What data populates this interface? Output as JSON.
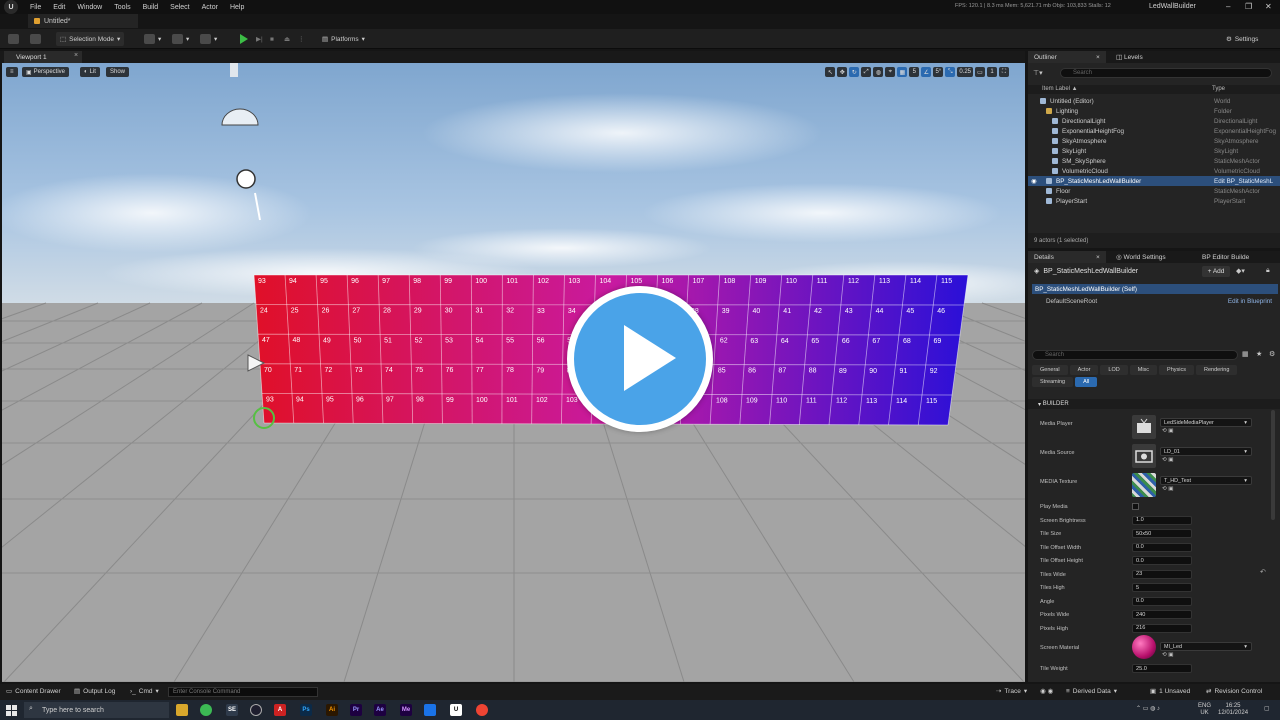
{
  "menubar": {
    "logo_text": "U",
    "items": [
      "File",
      "Edit",
      "Window",
      "Tools",
      "Build",
      "Select",
      "Actor",
      "Help"
    ],
    "perf": "FPS: 120.1  |  8.3 ms  Mem: 5,621.71 mb  Objs: 103,833  Stalls: 12",
    "window_title": "LedWallBuilder",
    "controls": [
      "–",
      "❐",
      "✕"
    ]
  },
  "doc_tab": {
    "label": "Untitled*"
  },
  "toolbar": {
    "selection_mode": "Selection Mode",
    "platforms": "Platforms",
    "settings": "Settings"
  },
  "viewport": {
    "tab_label": "Viewport 1",
    "perspective": "Perspective",
    "lit": "Lit",
    "show": "Show",
    "grid_size": "5",
    "angle": "5°",
    "scale": "0.25",
    "camera_speed": "1",
    "tile_numbers_top": [
      "93",
      "94",
      "95",
      "96",
      "97",
      "98",
      "99",
      "100",
      "101",
      "102",
      "103",
      "104",
      "105",
      "106",
      "107",
      "108",
      "109",
      "110",
      "111",
      "112",
      "113",
      "114",
      "115"
    ],
    "tile_rows": 5,
    "tile_cols": 23
  },
  "outliner": {
    "tab_label": "Outliner",
    "levels_tab": "Levels",
    "search_placeholder": "Search",
    "col_label": "Item Label ▲",
    "col_type": "Type",
    "rows": [
      {
        "label": "Untitled (Editor)",
        "type": "World",
        "indent": 2,
        "folder": false
      },
      {
        "label": "Lighting",
        "type": "Folder",
        "indent": 3,
        "folder": true
      },
      {
        "label": "DirectionalLight",
        "type": "DirectionalLight",
        "indent": 4,
        "folder": false
      },
      {
        "label": "ExponentialHeightFog",
        "type": "ExponentialHeightFog",
        "indent": 4,
        "folder": false
      },
      {
        "label": "SkyAtmosphere",
        "type": "SkyAtmosphere",
        "indent": 4,
        "folder": false
      },
      {
        "label": "SkyLight",
        "type": "SkyLight",
        "indent": 4,
        "folder": false
      },
      {
        "label": "SM_SkySphere",
        "type": "StaticMeshActor",
        "indent": 4,
        "folder": false
      },
      {
        "label": "VolumetricCloud",
        "type": "VolumetricCloud",
        "indent": 4,
        "folder": false
      },
      {
        "label": "BP_StaticMeshLedWallBuilder",
        "type": "Edit BP_StaticMeshL",
        "indent": 3,
        "folder": false,
        "selected": true
      },
      {
        "label": "Floor",
        "type": "StaticMeshActor",
        "indent": 3,
        "folder": false
      },
      {
        "label": "PlayerStart",
        "type": "PlayerStart",
        "indent": 3,
        "folder": false
      }
    ],
    "footer": "9 actors (1 selected)"
  },
  "details": {
    "tab_label": "Details",
    "world_settings_tab": "World Settings",
    "bp_editor_tab": "BP Editor Builde",
    "actor_name": "BP_StaticMeshLedWallBuilder",
    "add_label": "+ Add",
    "self_component": "BP_StaticMeshLedWallBuilder (Self)",
    "root_component": "DefaultSceneRoot",
    "edit_in_blueprint": "Edit in Blueprint",
    "search_placeholder": "Search",
    "categories": [
      "General",
      "Actor",
      "LOD",
      "Misc",
      "Physics",
      "Rendering",
      "Streaming",
      "All"
    ],
    "section": "BUILDER",
    "media_player_label": "Media Player",
    "media_player_value": "LedSideMediaPlayer",
    "media_source_label": "Media Source",
    "media_source_value": "LD_01",
    "media_texture_label": "MEDIA Texture",
    "media_texture_value": "T_HD_Test",
    "props": [
      {
        "label": "Play Media",
        "value": null
      },
      {
        "label": "Screen Brightness",
        "value": "1.0"
      },
      {
        "label": "Tile Size",
        "value": "50x50"
      },
      {
        "label": "Tile Offset Width",
        "value": "0.0"
      },
      {
        "label": "Tile Offset Height",
        "value": "0.0"
      },
      {
        "label": "Tiles Wide",
        "value": "23"
      },
      {
        "label": "Tiles High",
        "value": "5"
      },
      {
        "label": "Angle",
        "value": "0.0"
      },
      {
        "label": "Pixels Wide",
        "value": "240"
      },
      {
        "label": "Pixels High",
        "value": "216"
      }
    ],
    "screen_material_label": "Screen Material",
    "screen_material_value": "MI_Led",
    "tile_weight_label": "Tile Weight",
    "tile_weight_value": "25.0"
  },
  "statusbar": {
    "content_drawer": "Content Drawer",
    "output_log": "Output Log",
    "cmd": "Cmd",
    "cmd_placeholder": "Enter Console Command",
    "trace": "Trace",
    "derived_data": "Derived Data",
    "unsaved": "1 Unsaved",
    "revision_control": "Revision Control"
  },
  "taskbar": {
    "search_placeholder": "Type here to search",
    "lang": "ENG",
    "region": "UK",
    "time": "16:25",
    "date": "12/01/2024"
  },
  "colors": {
    "accent": "#2b6ab0",
    "selection": "#2c4f7c",
    "wall_left": "#e01028",
    "wall_mid": "#c81aa0",
    "wall_right": "#2a10d8",
    "play_button": "#4aa3e8"
  }
}
